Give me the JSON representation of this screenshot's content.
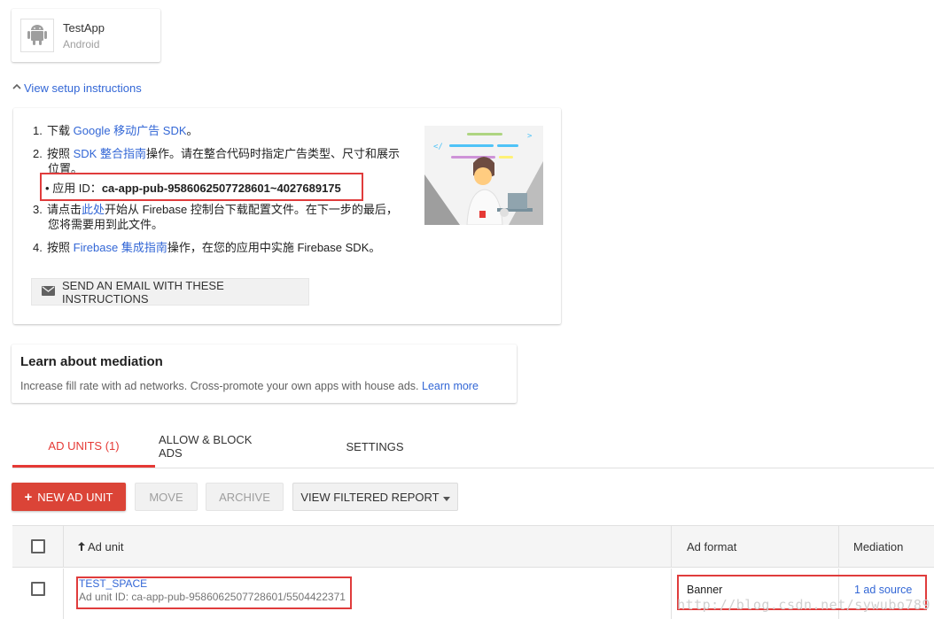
{
  "app": {
    "name": "TestApp",
    "platform": "Android"
  },
  "setup": {
    "toggle_label": "View setup instructions",
    "step1": {
      "num": "1.",
      "before": "下载 ",
      "link": "Google 移动广告 SDK",
      "after": "。"
    },
    "step2": {
      "num": "2.",
      "before": "按照 ",
      "link": "SDK 整合指南",
      "after": "操作。请在整合代码时指定广告类型、尺寸和展示",
      "line2": "位置。"
    },
    "app_id": {
      "label": "应用 ID：",
      "value": "ca-app-pub-9586062507728601~4027689175"
    },
    "step3": {
      "num": "3.",
      "before": "请点击",
      "link": "此处",
      "after": "开始从 Firebase 控制台下载配置文件。在下一步的最后，",
      "line2": "您将需要用到此文件。"
    },
    "step4": {
      "num": "4.",
      "before": "按照 ",
      "link": "Firebase 集成指南",
      "after": "操作，在您的应用中实施 Firebase SDK。"
    },
    "email_button": "SEND AN EMAIL WITH THESE INSTRUCTIONS"
  },
  "mediation": {
    "title": "Learn about mediation",
    "description": "Increase fill rate with ad networks. Cross-promote your own apps with house ads.",
    "link": "Learn more"
  },
  "tabs": [
    "AD UNITS (1)",
    "ALLOW & BLOCK ADS",
    "SETTINGS"
  ],
  "toolbar": {
    "new_ad_unit": "NEW AD UNIT",
    "move": "MOVE",
    "archive": "ARCHIVE",
    "view_filtered_report": "VIEW FILTERED REPORT"
  },
  "table": {
    "headers": {
      "ad_unit": "Ad unit",
      "ad_format": "Ad format",
      "mediation": "Mediation"
    },
    "rows": [
      {
        "name": "TEST_SPACE",
        "id": "Ad unit ID: ca-app-pub-9586062507728601/5504422371",
        "format": "Banner",
        "mediation": "1 ad source"
      }
    ]
  },
  "watermark": "http://blog.csdn.net/sywubo789",
  "colors": {
    "accent_red": "#db4437",
    "link_blue": "#3367d6",
    "highlight_box": "#e03c3c"
  }
}
